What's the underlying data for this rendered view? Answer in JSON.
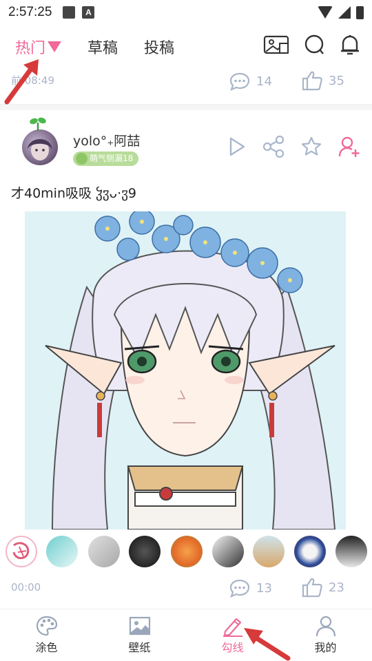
{
  "status_bar": {
    "time": "2:57:25"
  },
  "top_nav": {
    "tabs": [
      {
        "label": "热门",
        "active": true
      },
      {
        "label": "草稿",
        "active": false
      },
      {
        "label": "投稿",
        "active": false
      }
    ],
    "icons": [
      "gallery-icon",
      "chat-icon",
      "bell-icon"
    ]
  },
  "previous_post": {
    "time": "前 08:49",
    "comments": "14",
    "likes": "35"
  },
  "post": {
    "username": "yolo°₊阿喆",
    "badge": "萌气侧漏18",
    "caption": "才40min吸吸 ჴჳᴗ·ჳ9",
    "actions": [
      "play-icon",
      "share-icon",
      "star-icon",
      "follow-icon"
    ],
    "time": "00:00",
    "comments": "13",
    "likes": "23"
  },
  "colors": {
    "accent": "#f0699a",
    "muted": "#aab4c8",
    "badge": "#b8dc9a",
    "arrow": "#d63a3a"
  },
  "bottom_nav": {
    "items": [
      {
        "label": "涂色",
        "icon": "palette-icon",
        "active": false
      },
      {
        "label": "壁纸",
        "icon": "wallpaper-icon",
        "active": false
      },
      {
        "label": "勾线",
        "icon": "pen-icon",
        "active": true
      },
      {
        "label": "我的",
        "icon": "profile-icon",
        "active": false
      }
    ]
  }
}
